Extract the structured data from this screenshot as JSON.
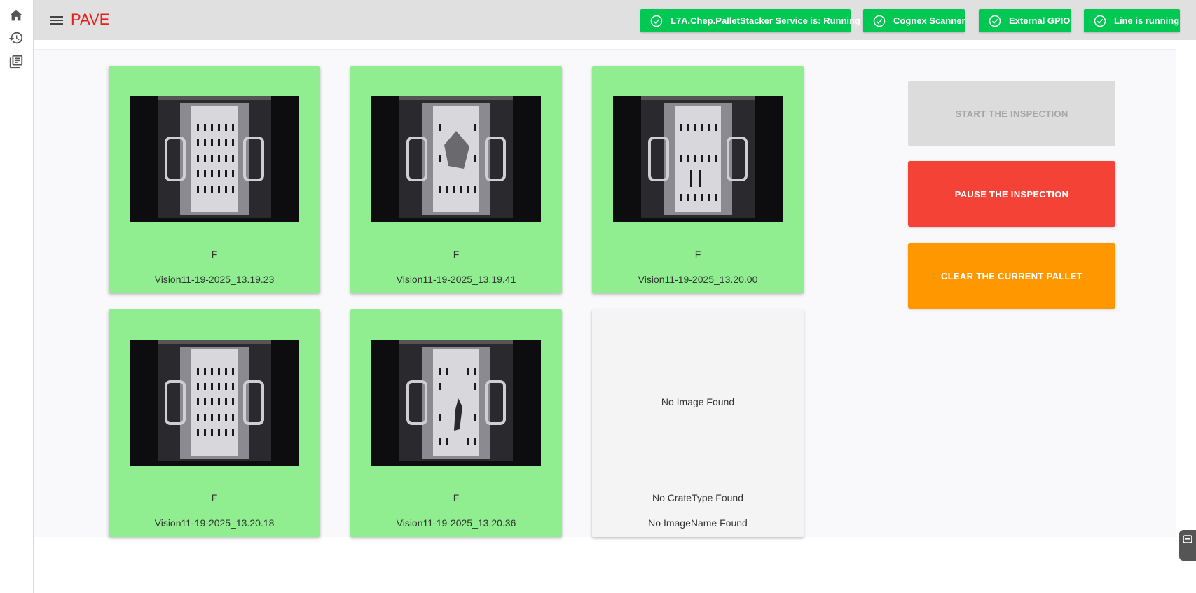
{
  "app": {
    "title": "PAVE"
  },
  "rail": {
    "icons": [
      "home-icon",
      "history-icon",
      "library-icon"
    ]
  },
  "status_badges": [
    {
      "label": "L7A.Chep.PalletStacker Service is: Running",
      "color": "#00c853"
    },
    {
      "label": "Cognex Scanner",
      "color": "#00c853"
    },
    {
      "label": "External GPIO",
      "color": "#00c853"
    },
    {
      "label": "Line is running",
      "color": "#00c853"
    }
  ],
  "cards": [
    {
      "crate_type": "F",
      "image_name": "Vision11-19-2025_13.19.23",
      "status_color": "#90ee90"
    },
    {
      "crate_type": "F",
      "image_name": "Vision11-19-2025_13.19.41",
      "status_color": "#90ee90"
    },
    {
      "crate_type": "F",
      "image_name": "Vision11-19-2025_13.20.00",
      "status_color": "#90ee90"
    },
    {
      "crate_type": "F",
      "image_name": "Vision11-19-2025_13.20.18",
      "status_color": "#90ee90"
    },
    {
      "crate_type": "F",
      "image_name": "Vision11-19-2025_13.20.36",
      "status_color": "#90ee90"
    },
    {
      "no_image": "No Image Found",
      "crate_type": "No CrateType Found",
      "image_name": "No ImageName Found",
      "status_color": "#f4f4f4"
    }
  ],
  "actions": {
    "start_label": "START THE INSPECTION",
    "pause_label": "PAUSE THE INSPECTION",
    "clear_label": "CLEAR THE CURRENT PALLET"
  },
  "colors": {
    "brand": "#e8201a",
    "ok": "#00c853",
    "pass_card": "#90ee90",
    "pause": "#f44336",
    "clear": "#ff9800",
    "disabled": "#dcdcdc"
  }
}
